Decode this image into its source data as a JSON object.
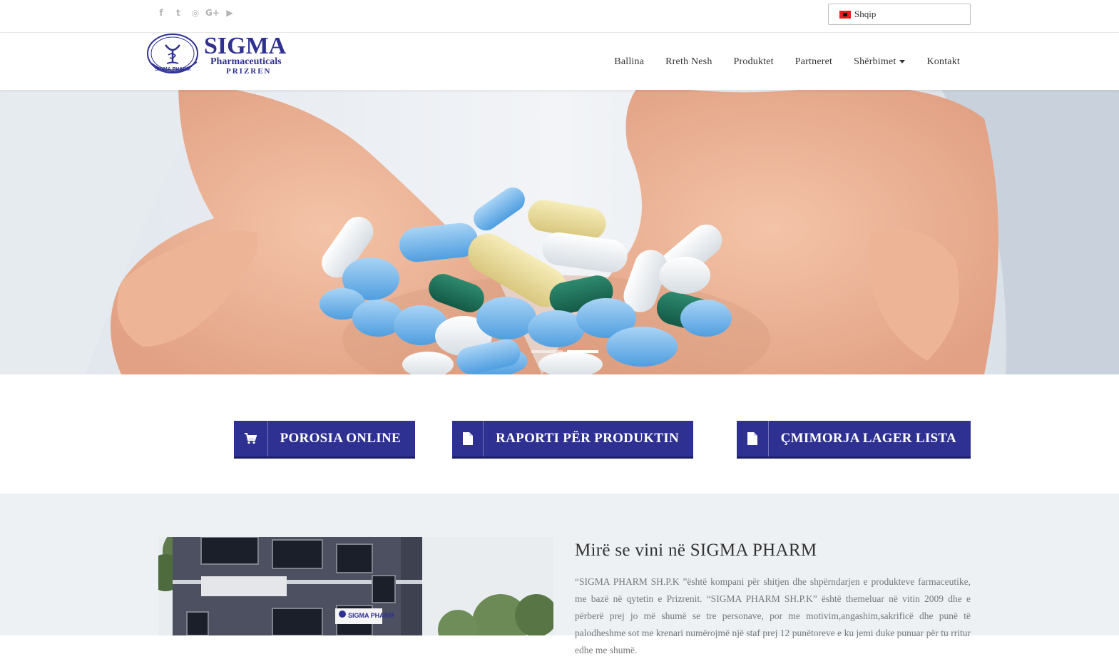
{
  "topbar": {
    "socials": [
      {
        "icon": "facebook-icon",
        "glyph": "f"
      },
      {
        "icon": "twitter-icon",
        "glyph": "t"
      },
      {
        "icon": "instagram-icon",
        "glyph": "◎"
      },
      {
        "icon": "google-plus-icon",
        "glyph": "G+"
      },
      {
        "icon": "youtube-icon",
        "glyph": "▶"
      }
    ],
    "language": "Shqip"
  },
  "logo": {
    "brand": "SIGMA",
    "line2": "Pharmaceuticals",
    "line3": "PRIZREN",
    "badge": "SIGMA PHARM"
  },
  "nav": {
    "items": [
      "Ballina",
      "Rreth Nesh",
      "Produktet",
      "Partneret",
      "Shërbimet",
      "Kontakt"
    ]
  },
  "cta": {
    "order": "POROSIA ONLINE",
    "report": "RAPORTI PËR PRODUKTIN",
    "pricelist": "ÇMIMORJA LAGER LISTA"
  },
  "welcome": {
    "title": "Mirë se vini në SIGMA PHARM",
    "text": "“SIGMA PHARM SH.P.K ”është kompani për shitjen dhe shpërndarjen e produkteve farmaceutike, me bazë në qytetin e Prizrenit. “SIGMA PHARM SH.P.K” është themeluar në vitin 2009 dhe e përberë prej jo më shumë se tre personave, por me motivim,angashim,sakrificë dhe punë të palodheshme sot me krenari numërojmë një staf prej 12 punëtoreve e ku jemi duke punuar për tu rritur edhe me shumë.",
    "building_sign": "SIGMA PHARM"
  },
  "colors": {
    "brand": "#2e3192",
    "brand_dark": "#1c1e66"
  }
}
